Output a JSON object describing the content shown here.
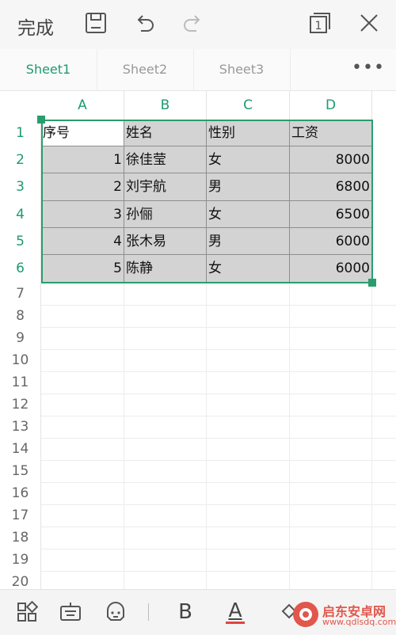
{
  "toolbar": {
    "done_label": "完成",
    "page_count": "1"
  },
  "tabs": [
    "Sheet1",
    "Sheet2",
    "Sheet3"
  ],
  "tabs_more": "•••",
  "columns": [
    "A",
    "B",
    "C",
    "D"
  ],
  "rows": [
    "1",
    "2",
    "3",
    "4",
    "5",
    "6",
    "7",
    "8",
    "9",
    "10",
    "11",
    "12",
    "13",
    "14",
    "15",
    "16",
    "17",
    "18",
    "19",
    "20"
  ],
  "table": [
    [
      "序号",
      "姓名",
      "性别",
      "工资"
    ],
    [
      "1",
      "徐佳莹",
      "女",
      "8000"
    ],
    [
      "2",
      "刘宇航",
      "男",
      "6800"
    ],
    [
      "3",
      "孙俪",
      "女",
      "6500"
    ],
    [
      "4",
      "张木易",
      "男",
      "6000"
    ],
    [
      "5",
      "陈静",
      "女",
      "6000"
    ]
  ],
  "bottom": {
    "bold_label": "B",
    "font_color_label": "A"
  },
  "watermark": {
    "title": "启东安卓网",
    "url": "www.qdlsdq.com"
  },
  "colors": {
    "accent": "#1f9a6e",
    "selection_fill": "#d3d3d3",
    "font_color_bar": "#e0443d"
  }
}
